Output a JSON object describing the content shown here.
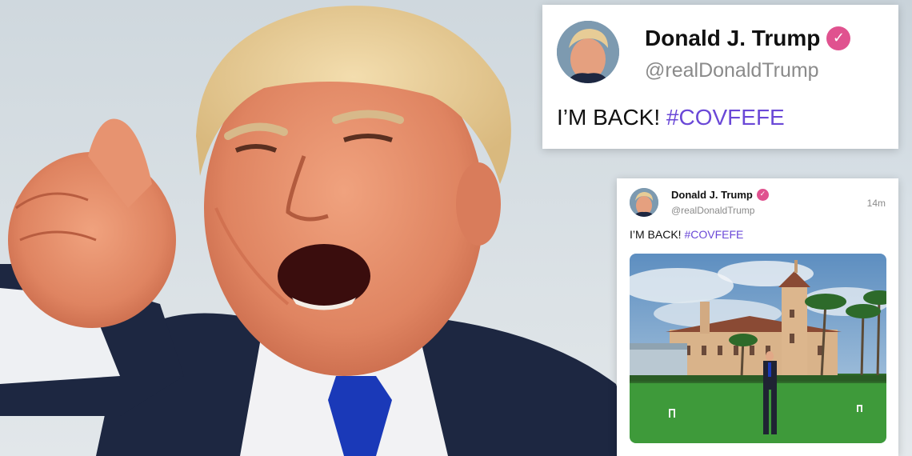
{
  "tweet_large": {
    "display_name": "Donald J. Trump",
    "handle": "@realDonaldTrump",
    "text": "I’M BACK!",
    "hashtag": "#COVFEFE",
    "verified_icon": "check-badge-icon",
    "verified_color": "#e0528f"
  },
  "tweet_small": {
    "display_name": "Donald J. Trump",
    "handle": "@realDonaldTrump",
    "timestamp": "14m",
    "text": "I’M BACK!",
    "hashtag": "#COVFEFE",
    "verified_icon": "check-badge-icon"
  },
  "colors": {
    "hashtag": "#6a48d7",
    "handle_gray": "#8a8a8a"
  }
}
